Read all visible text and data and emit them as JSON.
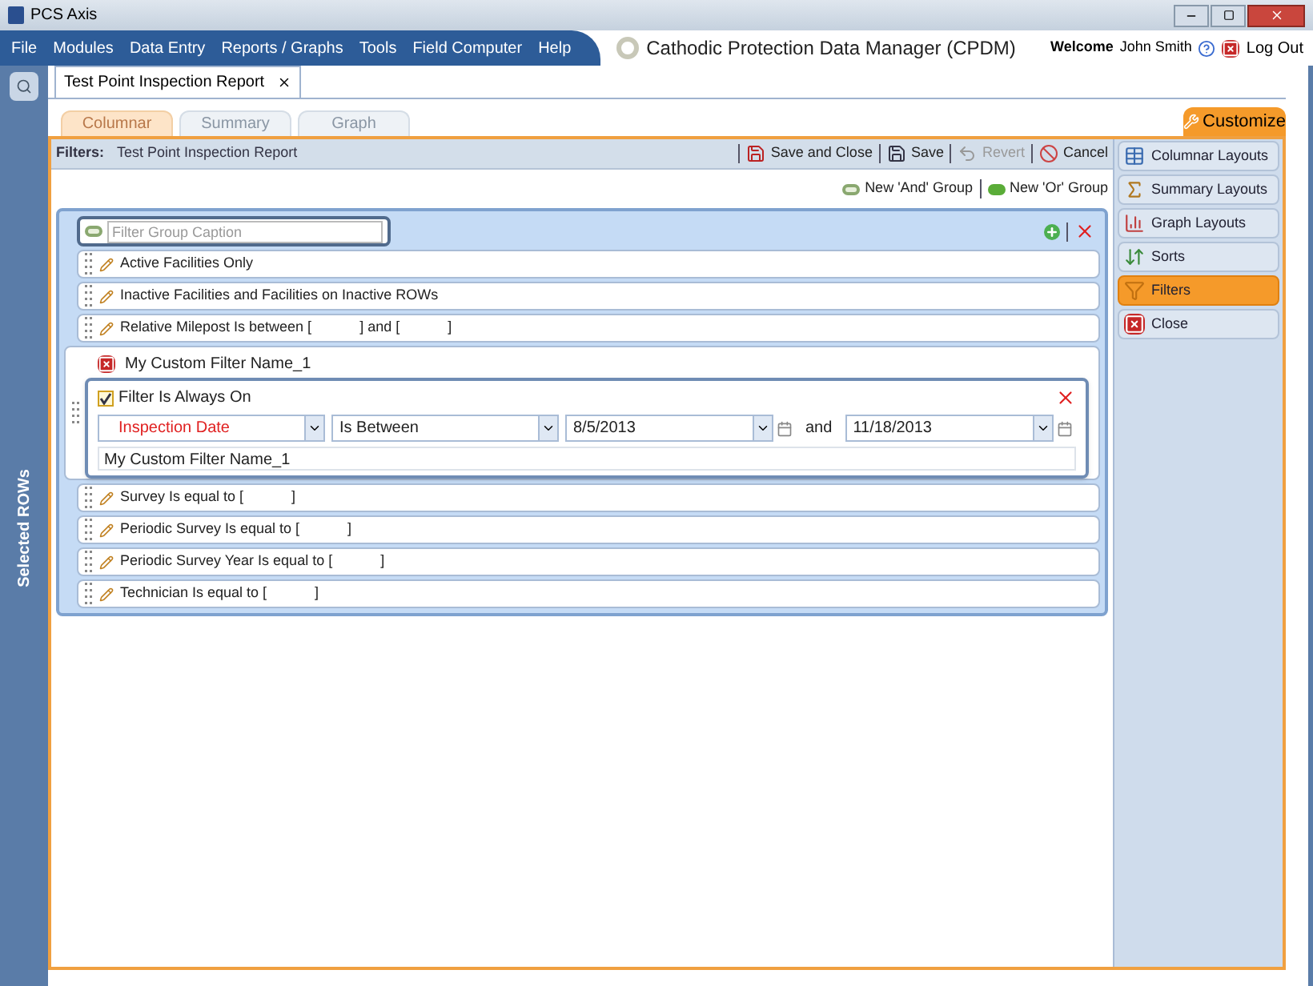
{
  "window": {
    "title": "PCS Axis"
  },
  "menu": [
    "File",
    "Modules",
    "Data Entry",
    "Reports / Graphs",
    "Tools",
    "Field Computer",
    "Help"
  ],
  "app_title": "Cathodic Protection Data Manager (CPDM)",
  "welcome": {
    "label": "Welcome",
    "user": "John Smith",
    "logout": "Log Out"
  },
  "side_strip": {
    "label": "Selected ROWs"
  },
  "doc_tabs": [
    {
      "label": "Test Point Inspection Report",
      "selected": true
    }
  ],
  "view_tabs": [
    {
      "label": "Columnar",
      "selected": true
    },
    {
      "label": "Summary",
      "selected": false
    },
    {
      "label": "Graph",
      "selected": false
    }
  ],
  "customize": "Customize",
  "filters_bar": {
    "label": "Filters:",
    "name": "Test Point Inspection Report",
    "actions": [
      {
        "kind": "save_close",
        "label": "Save and Close",
        "disabled": false
      },
      {
        "kind": "save",
        "label": "Save",
        "disabled": false
      },
      {
        "kind": "revert",
        "label": "Revert",
        "disabled": true
      },
      {
        "kind": "cancel",
        "label": "Cancel",
        "disabled": false
      }
    ]
  },
  "group_actions": [
    {
      "label": "New 'And' Group",
      "kind": "and"
    },
    {
      "label": "New 'Or' Group",
      "kind": "or"
    }
  ],
  "group": {
    "caption_placeholder": "Filter Group Caption"
  },
  "filters": [
    {
      "kind": "simple",
      "text": "Active Facilities Only"
    },
    {
      "kind": "simple",
      "text": "Inactive Facilities and Facilities on Inactive ROWs"
    },
    {
      "kind": "simple",
      "text": "Relative Milepost Is between [            ] and [            ]"
    },
    {
      "kind": "custom",
      "text": "My Custom Filter Name_1",
      "always_on_label": "Filter Is Always On",
      "always_on": true,
      "field": "Inspection Date",
      "operator": "Is Between",
      "value_1": "8/5/2013",
      "joiner": "and",
      "value_2": "11/18/2013",
      "name_value": "My Custom Filter Name_1"
    },
    {
      "kind": "simple",
      "text": "Survey Is equal to [            ]"
    },
    {
      "kind": "simple",
      "text": "Periodic Survey Is equal to [            ]"
    },
    {
      "kind": "simple",
      "text": "Periodic Survey Year Is equal to [            ]"
    },
    {
      "kind": "simple",
      "text": "Technician Is equal to [            ]"
    }
  ],
  "customize_menu": [
    {
      "kind": "columnar",
      "label": "Columnar Layouts",
      "selected": false
    },
    {
      "kind": "summary",
      "label": "Summary Layouts",
      "selected": false
    },
    {
      "kind": "graph",
      "label": "Graph Layouts",
      "selected": false
    },
    {
      "kind": "sorts",
      "label": "Sorts",
      "selected": false
    },
    {
      "kind": "filters",
      "label": "Filters",
      "selected": true
    },
    {
      "kind": "close",
      "label": "Close",
      "selected": false
    }
  ]
}
